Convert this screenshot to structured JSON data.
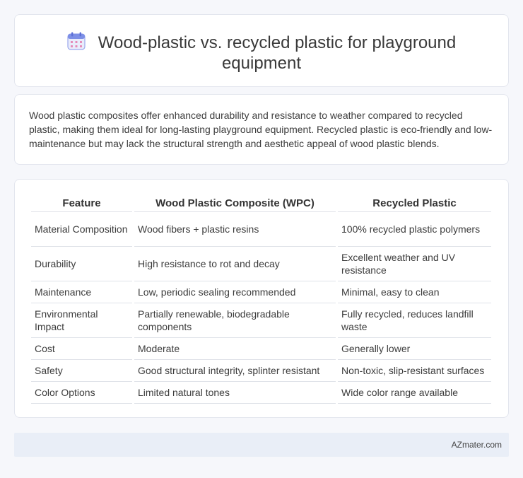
{
  "header": {
    "title_line1": "Wood-plastic vs. recycled plastic for playground",
    "title_line2": "equipment",
    "icon": "calendar-icon"
  },
  "intro": "Wood plastic composites offer enhanced durability and resistance to weather compared to recycled plastic, making them ideal for long-lasting playground equipment. Recycled plastic is eco-friendly and low-maintenance but may lack the structural strength and aesthetic appeal of wood plastic blends.",
  "table": {
    "headers": [
      "Feature",
      "Wood Plastic Composite (WPC)",
      "Recycled Plastic"
    ],
    "rows": [
      [
        "Material Composition",
        "Wood fibers + plastic resins",
        "100% recycled plastic polymers"
      ],
      [
        "Durability",
        "High resistance to rot and decay",
        "Excellent weather and UV resistance"
      ],
      [
        "Maintenance",
        "Low, periodic sealing recommended",
        "Minimal, easy to clean"
      ],
      [
        "Environmental Impact",
        "Partially renewable, biodegradable components",
        "Fully recycled, reduces landfill waste"
      ],
      [
        "Cost",
        "Moderate",
        "Generally lower"
      ],
      [
        "Safety",
        "Good structural integrity, splinter resistant",
        "Non-toxic, slip-resistant surfaces"
      ],
      [
        "Color Options",
        "Limited natural tones",
        "Wide color range available"
      ]
    ]
  },
  "footer": {
    "brand": "AZmater.com"
  },
  "colors": {
    "background": "#f6f7fb",
    "card": "#ffffff",
    "footer": "#e9eef7",
    "icon_primary": "#7d8fe6",
    "icon_accent": "#e58ab8"
  }
}
